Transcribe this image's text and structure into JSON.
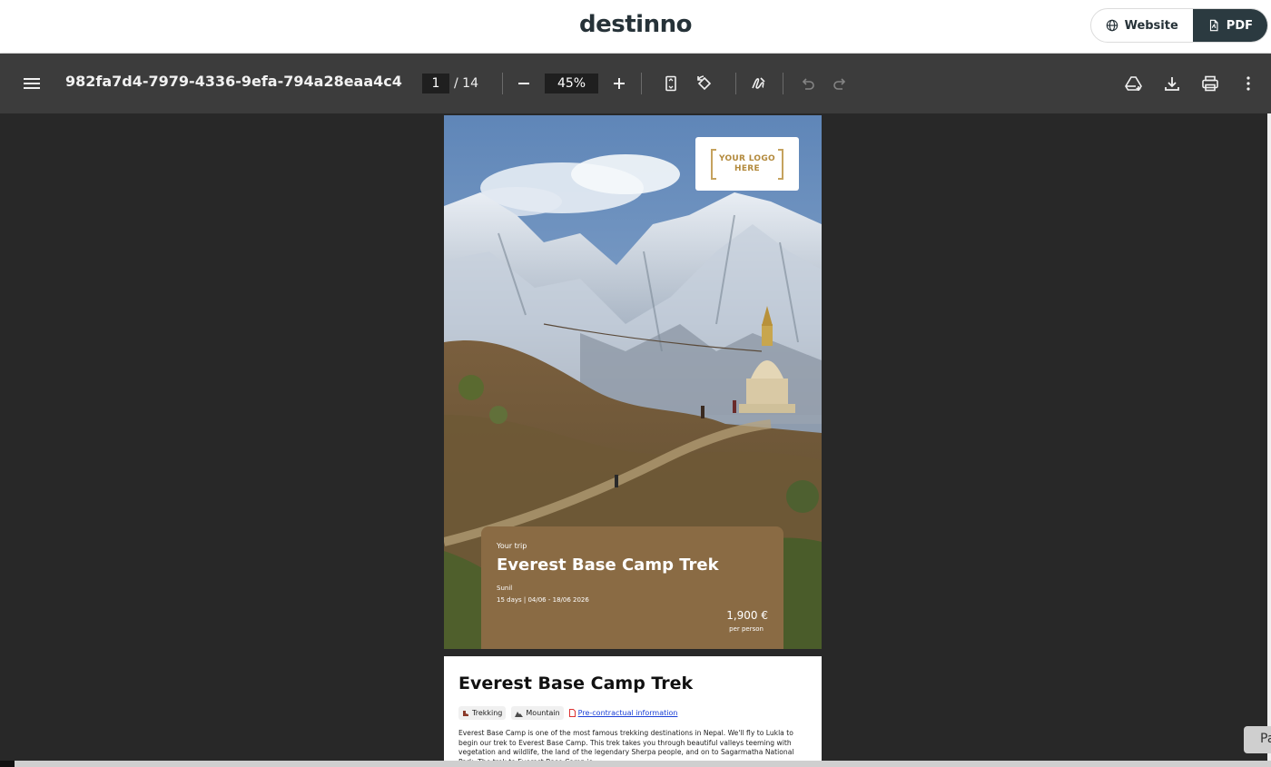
{
  "site": {
    "brand": "destinno",
    "toggle": {
      "website_label": "Website",
      "pdf_label": "PDF"
    }
  },
  "toolbar": {
    "doc_title": "982fa7d4-7979-4336-9efa-794a28eaa4c4",
    "page_current": "1",
    "page_total": "/ 14",
    "zoom": "45%",
    "icons": [
      "menu-icon",
      "zoom-out-icon",
      "zoom-in-icon",
      "fit-page-icon",
      "rotate-icon",
      "annotate-icon",
      "undo-icon",
      "redo-icon",
      "drive-icon",
      "download-icon",
      "print-icon",
      "more-icon"
    ]
  },
  "cover": {
    "logo_text_1": "YOUR LOGO",
    "logo_text_2": "HERE",
    "kicker": "Your trip",
    "title": "Everest Base Camp Trek",
    "traveler": "Sunil",
    "dates": "15 days | 04/06 - 18/06 2026",
    "price": "1,900 €",
    "price_note": "per person",
    "card_color": "#8a6b44"
  },
  "page2": {
    "title": "Everest Base Camp Trek",
    "tags": [
      "Trekking",
      "Mountain"
    ],
    "link": "Pre-contractual information",
    "description": "Everest Base Camp is one of the most famous trekking destinations in Nepal. We'll fly to Lukla to begin our trek to Everest Base Camp. This trek takes you through beautiful valleys teeming with vegetation and wildlife, the land of the legendary Sherpa people, and on to Sagarmatha National Park. The trek to Everest Base Camp is"
  },
  "corner_button": "Pa"
}
